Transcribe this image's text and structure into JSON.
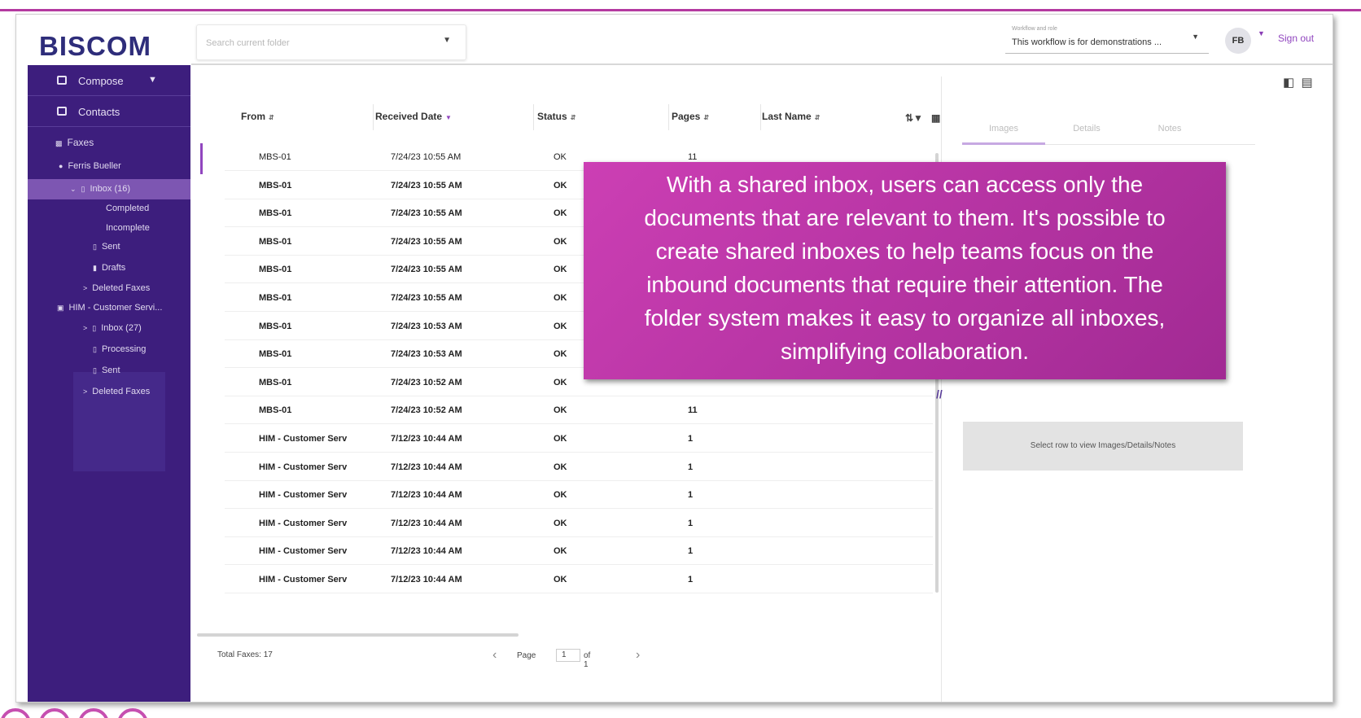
{
  "app": {
    "logo": "BISCOM"
  },
  "search": {
    "placeholder": "Search current folder"
  },
  "workflow": {
    "label": "Workflow and role",
    "value": "This workflow is for demonstrations ..."
  },
  "user": {
    "initials": "FB",
    "signout_label": "Sign out"
  },
  "sidebar": {
    "compose_label": "Compose",
    "contacts_label": "Contacts",
    "faxes_label": "Faxes",
    "tree": [
      {
        "label": "Ferris Bueller",
        "icon": "person-icon"
      },
      {
        "label": "Inbox (16)",
        "icon": "inbox-icon",
        "selected": true
      },
      {
        "label": "Completed"
      },
      {
        "label": "Incomplete"
      },
      {
        "label": "Sent",
        "icon": "inbox-icon"
      },
      {
        "label": "Drafts",
        "icon": "document-icon"
      },
      {
        "label": "Deleted Faxes"
      },
      {
        "label": "HIM - Customer Servi...",
        "icon": "shared-inbox-icon"
      },
      {
        "label": "Inbox (27)",
        "icon": "inbox-icon"
      },
      {
        "label": "Processing",
        "icon": "inbox-icon"
      },
      {
        "label": "Sent",
        "icon": "inbox-icon"
      },
      {
        "label": "Deleted Faxes"
      }
    ]
  },
  "table": {
    "columns": [
      "From",
      "Received Date",
      "Status",
      "Pages",
      "Last Name"
    ],
    "rows": [
      {
        "from": "MBS-01",
        "date": "7/24/23 10:55 AM",
        "status": "OK",
        "pages": "11",
        "bold": false
      },
      {
        "from": "MBS-01",
        "date": "7/24/23 10:55 AM",
        "status": "OK",
        "pages": "",
        "bold": true
      },
      {
        "from": "MBS-01",
        "date": "7/24/23 10:55 AM",
        "status": "OK",
        "pages": "",
        "bold": true
      },
      {
        "from": "MBS-01",
        "date": "7/24/23 10:55 AM",
        "status": "OK",
        "pages": "",
        "bold": true
      },
      {
        "from": "MBS-01",
        "date": "7/24/23 10:55 AM",
        "status": "OK",
        "pages": "",
        "bold": true
      },
      {
        "from": "MBS-01",
        "date": "7/24/23 10:55 AM",
        "status": "OK",
        "pages": "",
        "bold": true
      },
      {
        "from": "MBS-01",
        "date": "7/24/23 10:53 AM",
        "status": "OK",
        "pages": "",
        "bold": true
      },
      {
        "from": "MBS-01",
        "date": "7/24/23 10:53 AM",
        "status": "OK",
        "pages": "",
        "bold": true
      },
      {
        "from": "MBS-01",
        "date": "7/24/23 10:52 AM",
        "status": "OK",
        "pages": "",
        "bold": true
      },
      {
        "from": "MBS-01",
        "date": "7/24/23 10:52 AM",
        "status": "OK",
        "pages": "11",
        "bold": true
      },
      {
        "from": "HIM - Customer Serv",
        "date": "7/12/23 10:44 AM",
        "status": "OK",
        "pages": "1",
        "bold": true
      },
      {
        "from": "HIM - Customer Serv",
        "date": "7/12/23 10:44 AM",
        "status": "OK",
        "pages": "1",
        "bold": true
      },
      {
        "from": "HIM - Customer Serv",
        "date": "7/12/23 10:44 AM",
        "status": "OK",
        "pages": "1",
        "bold": true
      },
      {
        "from": "HIM - Customer Serv",
        "date": "7/12/23 10:44 AM",
        "status": "OK",
        "pages": "1",
        "bold": true
      },
      {
        "from": "HIM - Customer Serv",
        "date": "7/12/23 10:44 AM",
        "status": "OK",
        "pages": "1",
        "bold": true
      },
      {
        "from": "HIM - Customer Serv",
        "date": "7/12/23 10:44 AM",
        "status": "OK",
        "pages": "1",
        "bold": true
      }
    ]
  },
  "footer": {
    "total": "Total Faxes: 17",
    "page_label": "Page",
    "page_value": "1",
    "of_label": "of 1"
  },
  "details": {
    "tabs": [
      "Images",
      "Details",
      "Notes"
    ],
    "empty_message": "Select row to view Images/Details/Notes"
  },
  "callout": {
    "lines": [
      "With a shared inbox, users can access only the",
      "documents that are relevant to them. It's possible to",
      "create shared inboxes to help teams focus on the",
      "inbound documents that require their attention. The",
      "folder system makes it easy to organize all inboxes,",
      "simplifying collaboration."
    ]
  },
  "colors": {
    "sidebar": "#3d1e7d",
    "accent": "#9146bf",
    "callout": "#b8329f"
  }
}
